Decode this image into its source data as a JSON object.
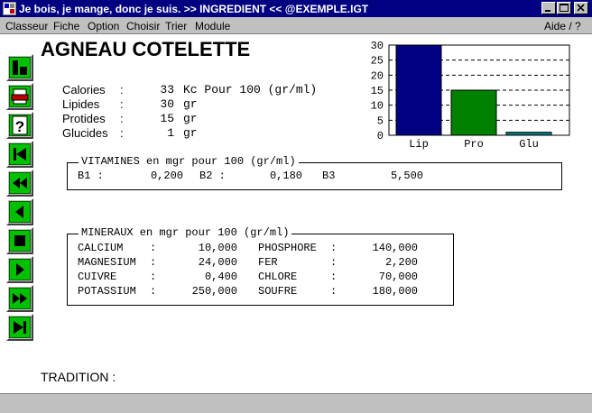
{
  "window": {
    "title": "Je bois, je mange, donc je suis. >> INGREDIENT << @EXEMPLE.IGT"
  },
  "menu": {
    "items": [
      "Classeur",
      "Fiche",
      "Option",
      "Choisir",
      "Trier",
      "Module"
    ],
    "help": "Aide / ?"
  },
  "toolbar": {
    "buttons": [
      "chart-view",
      "print",
      "help",
      "first-record",
      "fast-rewind",
      "previous",
      "stop",
      "next",
      "fast-forward",
      "last-record"
    ]
  },
  "ingredient": {
    "name": "AGNEAU COTELETTE",
    "nutrients": [
      {
        "label": "Calories",
        "sep": ":",
        "value": "33",
        "unit": "Kc Pour 100 (gr/ml)"
      },
      {
        "label": "Lipides",
        "sep": ":",
        "value": "30",
        "unit": "gr"
      },
      {
        "label": "Protides",
        "sep": ":",
        "value": "15",
        "unit": "gr"
      },
      {
        "label": "Glucides",
        "sep": ":",
        "value": "1",
        "unit": "gr"
      }
    ],
    "tradition_label": "TRADITION :"
  },
  "vitamines": {
    "title": "VITAMINES en mgr pour 100 (gr/ml)",
    "items": [
      {
        "label": "B1 :",
        "value": "0,200"
      },
      {
        "label": "B2 :",
        "value": "0,180"
      },
      {
        "label": "B3",
        "value": "5,500"
      }
    ]
  },
  "mineraux": {
    "title": "MINERAUX en mgr pour 100 (gr/ml)",
    "rows": [
      {
        "n1": "CALCIUM",
        "v1": "10,000",
        "n2": "PHOSPHORE",
        "v2": "140,000"
      },
      {
        "n1": "MAGNESIUM",
        "v1": "24,000",
        "n2": "FER",
        "v2": "2,200"
      },
      {
        "n1": "CUIVRE",
        "v1": "0,400",
        "n2": "CHLORE",
        "v2": "70,000"
      },
      {
        "n1": "POTASSIUM",
        "v1": "250,000",
        "n2": "SOUFRE",
        "v2": "180,000"
      }
    ],
    "sep": ":"
  },
  "chart_data": {
    "type": "bar",
    "categories": [
      "Lip",
      "Pro",
      "Glu"
    ],
    "values": [
      30,
      15,
      1
    ],
    "colors": [
      "#000080",
      "#008000",
      "#008080"
    ],
    "ylim": [
      0,
      30
    ],
    "yticks": [
      "0",
      "5",
      "10",
      "15",
      "20",
      "25",
      "30"
    ],
    "grid": "dashed horizontal"
  }
}
